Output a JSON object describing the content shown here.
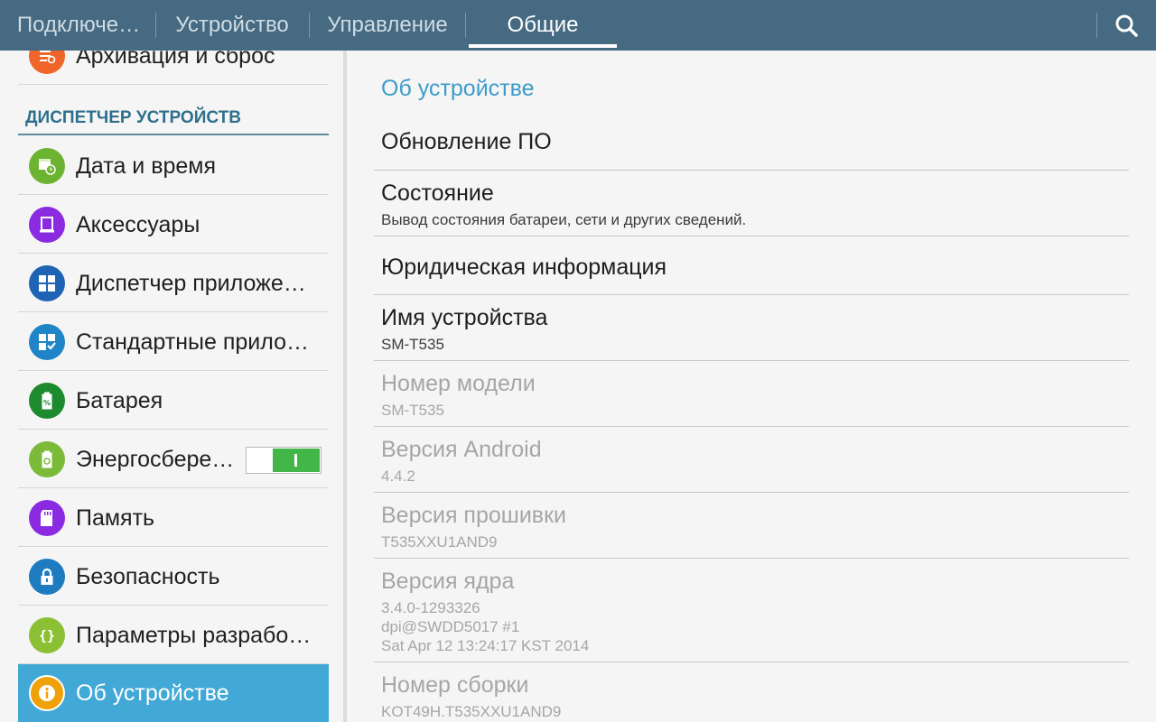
{
  "tabs": [
    {
      "label": "Подключе…"
    },
    {
      "label": "Устройство"
    },
    {
      "label": "Управление"
    },
    {
      "label": "Общие"
    }
  ],
  "active_tab": "Общие",
  "sidebar": {
    "partial_item": {
      "label": "Архивация и сброс",
      "icon": "backup-icon",
      "color": "#f0662a"
    },
    "section_header": "ДИСПЕТЧЕР УСТРОЙСТВ",
    "items": [
      {
        "label": "Дата и время",
        "icon": "calendar-clock-icon",
        "color": "#6db332"
      },
      {
        "label": "Аксессуары",
        "icon": "accessory-icon",
        "color": "#8a2be2"
      },
      {
        "label": "Диспетчер приложе…",
        "icon": "app-grid-icon",
        "color": "#1f64b4"
      },
      {
        "label": "Стандартные прило…",
        "icon": "default-apps-icon",
        "color": "#1f84c8"
      },
      {
        "label": "Батарея",
        "icon": "battery-icon",
        "color": "#1e8a2e"
      },
      {
        "label": "Энергосбере…",
        "icon": "power-saving-icon",
        "color": "#7cba3a"
      },
      {
        "label": "Память",
        "icon": "storage-icon",
        "color": "#8a2be2"
      },
      {
        "label": "Безопасность",
        "icon": "lock-icon",
        "color": "#1f7bc0"
      },
      {
        "label": "Параметры разрабо…",
        "icon": "developer-icon",
        "color": "#8cc034"
      },
      {
        "label": "Об устройстве",
        "icon": "info-icon",
        "color": "#f0a10a"
      }
    ],
    "power_saving_toggle": "on",
    "selected_item": "Об устройстве"
  },
  "content": {
    "title": "Об устройстве",
    "rows": [
      {
        "title": "Обновление ПО",
        "subtitle": ""
      },
      {
        "title": "Состояние",
        "subtitle": "Вывод состояния батареи, сети и других сведений."
      },
      {
        "title": "Юридическая информация",
        "subtitle": ""
      },
      {
        "title": "Имя устройства",
        "subtitle": "SM-T535"
      },
      {
        "title": "Номер модели",
        "subtitle": "SM-T535"
      },
      {
        "title": "Версия Android",
        "subtitle": "4.4.2"
      },
      {
        "title": "Версия прошивки",
        "subtitle": "T535XXU1AND9"
      },
      {
        "title": "Версия ядра",
        "subtitle": "3.4.0-1293326\ndpi@SWDD5017 #1\nSat Apr 12 13:24:17 KST 2014"
      },
      {
        "title": "Номер сборки",
        "subtitle": "KOT49H.T535XXU1AND9"
      }
    ]
  },
  "colors": {
    "topbar": "#456a82",
    "accent": "#3d9cc9",
    "selected_item": "#42a8d6",
    "toggle_on": "#43b649"
  }
}
